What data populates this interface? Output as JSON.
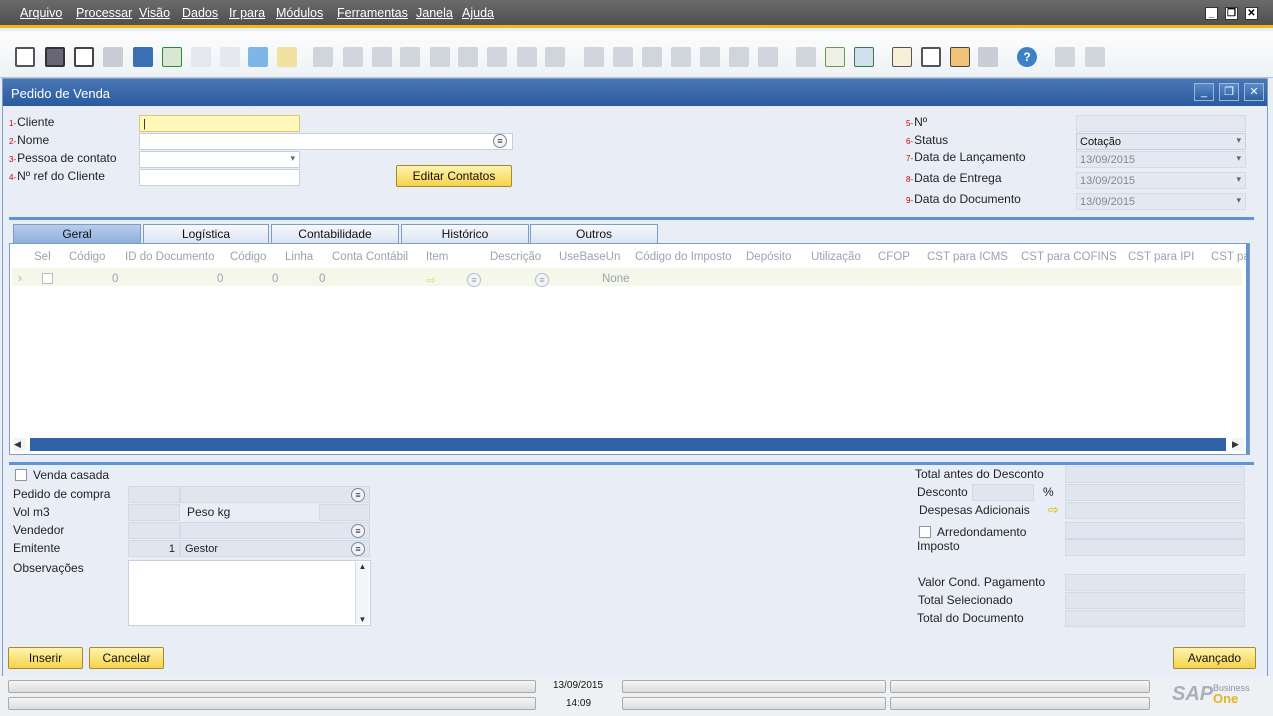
{
  "menu": [
    "Arquivo",
    "Processar",
    "Visão",
    "Dados",
    "Ir para",
    "Módulos",
    "Ferramentas",
    "Janela",
    "Ajuda"
  ],
  "window": {
    "title": "Pedido de Venda"
  },
  "header": {
    "cliente_label": "Cliente",
    "cliente_num": "1-",
    "nome_label": "Nome",
    "nome_num": "2-",
    "contato_label": "Pessoa de contato",
    "contato_num": "3-",
    "ref_label": "Nº ref do Cliente",
    "ref_num": "4-",
    "editar_contatos": "Editar Contatos",
    "no_label": "Nº",
    "no_num": "5-",
    "status_label": "Status",
    "status_num": "6-",
    "status_value": "Cotação",
    "lanc_label": "Data de Lançamento",
    "lanc_num": "7-",
    "lanc_value": "13/09/2015",
    "entrega_label": "Data de Entrega",
    "entrega_num": "8-",
    "entrega_value": "13/09/2015",
    "documento_label": "Data do Documento",
    "documento_num": "9-",
    "documento_value": "13/09/2015"
  },
  "tabs": [
    "Geral",
    "Logística",
    "Contabilidade",
    "Histórico",
    "Outros"
  ],
  "grid": {
    "columns": [
      "Sel",
      "Código",
      "ID do Documento",
      "Código",
      "Linha",
      "Conta Contábil",
      "Item",
      "Descrição",
      "UseBaseUn",
      "Código do Imposto",
      "Depósito",
      "Utilização",
      "CFOP",
      "CST para ICMS",
      "CST para COFINS",
      "CST para IPI",
      "CST pa"
    ],
    "row": {
      "codigo": "0",
      "id_doc": "0",
      "codigo2": "0",
      "linha": "0",
      "usebase": "None"
    }
  },
  "footer": {
    "venda_casada": "Venda casada",
    "pedido_compra": "Pedido de compra",
    "vol": "Vol m3",
    "peso": "Peso kg",
    "vendedor": "Vendedor",
    "emitente": "Emitente",
    "emitente_code": "1",
    "emitente_name": "Gestor",
    "observacoes": "Observações",
    "total_antes": "Total antes do Desconto",
    "desconto": "Desconto",
    "percent": "%",
    "despesas": "Despesas Adicionais",
    "arredondamento": "Arredondamento",
    "imposto": "Imposto",
    "valor_cond": "Valor Cond. Pagamento",
    "total_sel": "Total Selecionado",
    "total_doc": "Total do Documento"
  },
  "buttons": {
    "inserir": "Inserir",
    "cancelar": "Cancelar",
    "avancado": "Avançado"
  },
  "status": {
    "date": "13/09/2015",
    "time": "14:09",
    "brand_main": "SAP",
    "brand_small": "Business",
    "brand_one": "One"
  }
}
